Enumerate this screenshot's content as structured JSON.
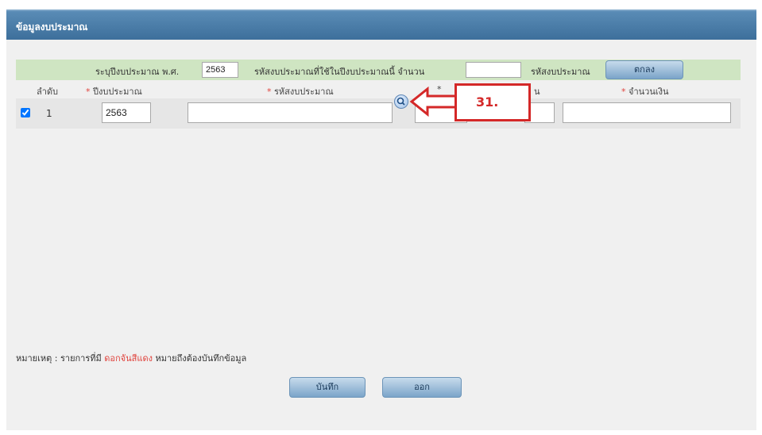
{
  "window": {
    "title": "ข้อมูลงบประมาณ"
  },
  "filter_row": {
    "label_year": "ระบุปีงบประมาณ พ.ศ.",
    "year_value": "2563",
    "label_count": "รหัสงบประมาณที่ใช้ในปีงบประมาณนี้ จำนวน",
    "count_value": "",
    "label_unit": "รหัสงบประมาณ",
    "ok_button": "ตกลง"
  },
  "table": {
    "headers": {
      "index": "ลำดับ",
      "year": "ปีงบประมาณ",
      "code": "รหัสงบประมาณ",
      "col4": "*",
      "col5": "น",
      "amount": "จำนวนเงิน",
      "required_mark": "*"
    },
    "rows": [
      {
        "checked": true,
        "index": "1",
        "year": "2563",
        "code": "",
        "col4": "",
        "col5": "",
        "amount": ""
      }
    ]
  },
  "note": {
    "prefix": "หมายเหตุ : รายการที่มี",
    "highlight": "ดอกจันสีแดง",
    "suffix": "หมายถึงต้องบันทึกข้อมูล"
  },
  "buttons": {
    "save": "บันทึก",
    "exit": "ออก"
  },
  "annotation": {
    "label": "31."
  },
  "colors": {
    "titlebar": "#4a7fab",
    "filter_row": "#cfe5c2",
    "required": "#e0433d",
    "callout": "#d42828"
  }
}
